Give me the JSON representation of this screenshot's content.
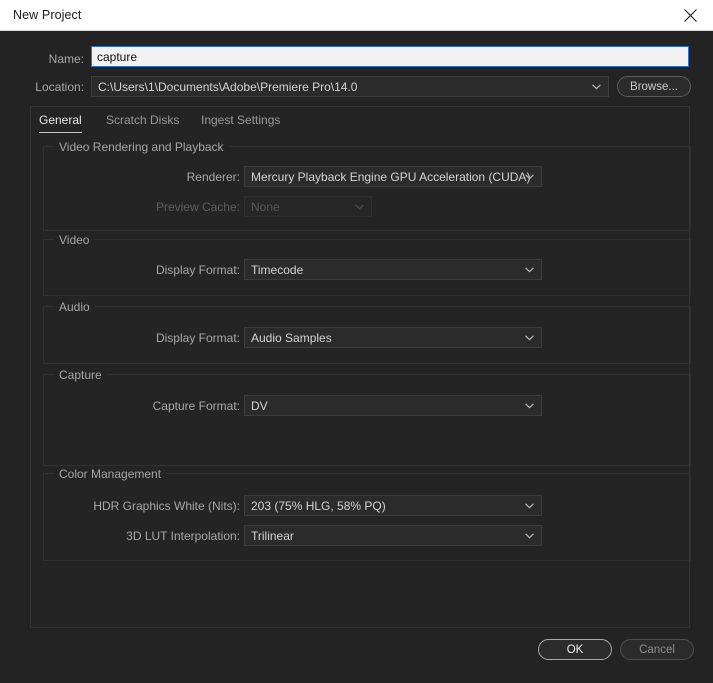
{
  "window": {
    "title": "New Project",
    "close_icon": "close-icon"
  },
  "form": {
    "name_label": "Name:",
    "name_value": "capture",
    "name_placeholder": "",
    "location_label": "Location:",
    "location_value": "C:\\Users\\1\\Documents\\Adobe\\Premiere Pro\\14.0",
    "browse_label": "Browse...",
    "chevron_icon": "chevron-down-icon"
  },
  "tabs": [
    {
      "label": "General",
      "active": true
    },
    {
      "label": "Scratch Disks",
      "active": false
    },
    {
      "label": "Ingest Settings",
      "active": false
    }
  ],
  "groups": {
    "video_rendering": {
      "legend": "Video Rendering and Playback",
      "renderer_label": "Renderer:",
      "renderer_value": "Mercury Playback Engine GPU Acceleration (CUDA)",
      "preview_cache_label": "Preview Cache:",
      "preview_cache_value": "None"
    },
    "video": {
      "legend": "Video",
      "display_format_label": "Display Format:",
      "display_format_value": "Timecode"
    },
    "audio": {
      "legend": "Audio",
      "display_format_label": "Display Format:",
      "display_format_value": "Audio Samples"
    },
    "capture": {
      "legend": "Capture",
      "capture_format_label": "Capture Format:",
      "capture_format_value": "DV"
    },
    "color_management": {
      "legend": "Color Management",
      "hdr_label": "HDR Graphics White (Nits):",
      "hdr_value": "203 (75% HLG, 58% PQ)",
      "lut_label": "3D LUT Interpolation:",
      "lut_value": "Trilinear"
    }
  },
  "footer": {
    "ok_label": "OK",
    "cancel_label": "Cancel"
  },
  "colors": {
    "dialog_bg": "#232323",
    "panel_bg": "#242424",
    "titlebar_bg": "#ffffff",
    "focus_border": "#2d6fd0",
    "text_primary": "#d4d4d4",
    "text_label": "#a8a8a8",
    "text_disabled": "#5e5e5e"
  }
}
